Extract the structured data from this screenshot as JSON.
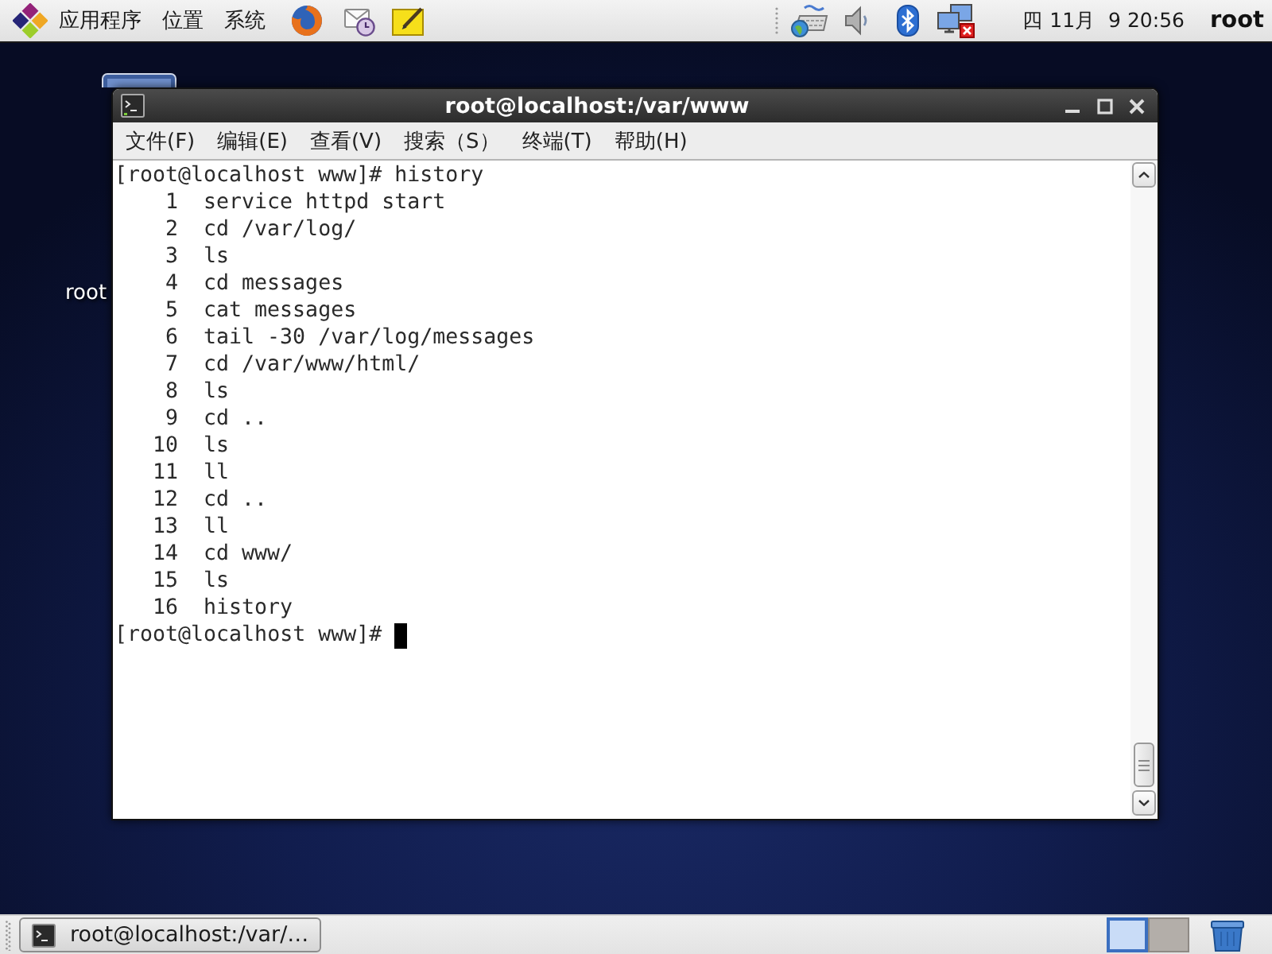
{
  "top_panel": {
    "menus": [
      "应用程序",
      "位置",
      "系统"
    ],
    "clock": "四 11月  9 20:56",
    "user": "root"
  },
  "desktop": {
    "icons": [
      {
        "label": "root"
      }
    ]
  },
  "terminal": {
    "title": "root@localhost:/var/www",
    "menu": [
      "文件(F)",
      "编辑(E)",
      "查看(V)",
      "搜索（S）",
      "终端(T)",
      "帮助(H)"
    ],
    "lines": [
      {
        "kind": "prompt",
        "prompt": "[root@localhost www]#",
        "command": "history"
      },
      {
        "kind": "history",
        "number": "1",
        "command": "service httpd start"
      },
      {
        "kind": "history",
        "number": "2",
        "command": "cd /var/log/"
      },
      {
        "kind": "history",
        "number": "3",
        "command": "ls"
      },
      {
        "kind": "history",
        "number": "4",
        "command": "cd messages"
      },
      {
        "kind": "history",
        "number": "5",
        "command": "cat messages"
      },
      {
        "kind": "history",
        "number": "6",
        "command": "tail -30 /var/log/messages"
      },
      {
        "kind": "history",
        "number": "7",
        "command": "cd /var/www/html/"
      },
      {
        "kind": "history",
        "number": "8",
        "command": "ls"
      },
      {
        "kind": "history",
        "number": "9",
        "command": "cd .."
      },
      {
        "kind": "history",
        "number": "10",
        "command": "ls"
      },
      {
        "kind": "history",
        "number": "11",
        "command": "ll"
      },
      {
        "kind": "history",
        "number": "12",
        "command": "cd .."
      },
      {
        "kind": "history",
        "number": "13",
        "command": "ll"
      },
      {
        "kind": "history",
        "number": "14",
        "command": "cd www/"
      },
      {
        "kind": "history",
        "number": "15",
        "command": "ls"
      },
      {
        "kind": "history",
        "number": "16",
        "command": "history"
      },
      {
        "kind": "prompt",
        "prompt": "[root@localhost www]#",
        "cursor": true
      }
    ]
  },
  "bottom_panel": {
    "tasks": [
      {
        "label": "root@localhost:/var/…"
      }
    ],
    "workspaces": [
      {
        "selected": true
      },
      {
        "selected": false
      }
    ]
  }
}
